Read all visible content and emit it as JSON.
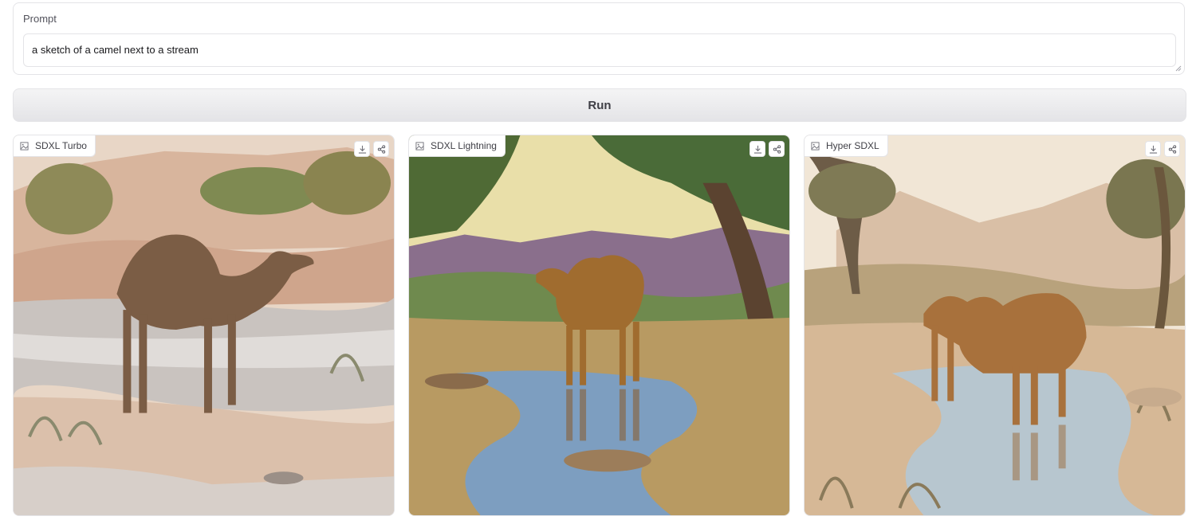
{
  "prompt": {
    "label": "Prompt",
    "value": "a sketch of a camel next to a stream"
  },
  "run_button": {
    "label": "Run"
  },
  "gallery": [
    {
      "label": "SDXL Turbo",
      "icon": "image-icon"
    },
    {
      "label": "SDXL Lightning",
      "icon": "image-icon"
    },
    {
      "label": "Hyper SDXL",
      "icon": "image-icon"
    }
  ],
  "actions": {
    "download_icon": "download-icon",
    "share_icon": "share-icon"
  }
}
